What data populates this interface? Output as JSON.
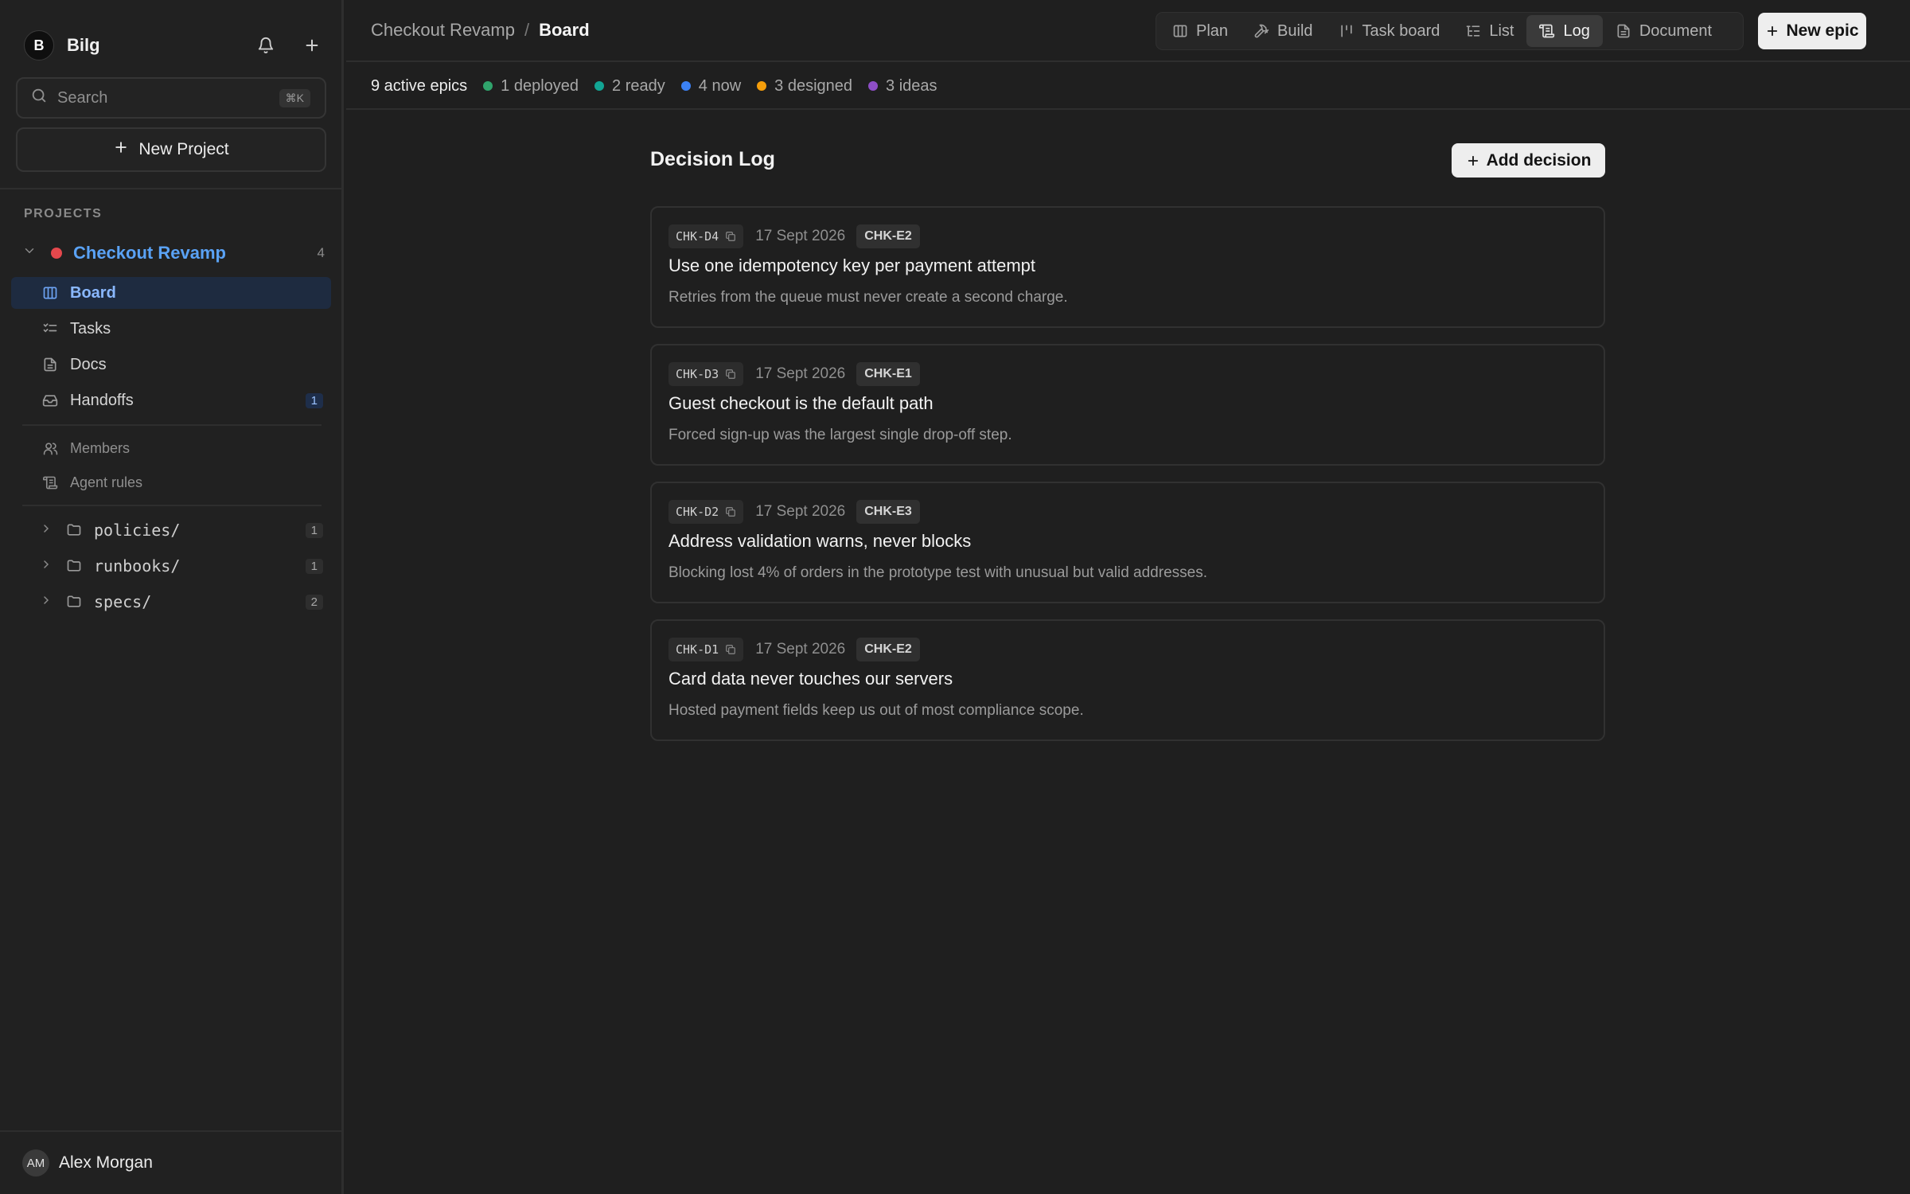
{
  "workspace": {
    "avatar_letter": "B",
    "name": "Bilg"
  },
  "search": {
    "placeholder": "Search",
    "shortcut": "⌘K"
  },
  "new_project_label": "New Project",
  "projects_label": "PROJECTS",
  "project": {
    "name": "Checkout Revamp",
    "count": "4",
    "dot_color": "#e5484d"
  },
  "nav": [
    {
      "label": "Board",
      "active": true,
      "icon": "board-icon"
    },
    {
      "label": "Tasks",
      "icon": "tasks-icon"
    },
    {
      "label": "Docs",
      "icon": "docs-icon"
    },
    {
      "label": "Handoffs",
      "icon": "inbox-icon",
      "badge": "1"
    }
  ],
  "subnav": [
    {
      "label": "Members",
      "icon": "members-icon"
    },
    {
      "label": "Agent rules",
      "icon": "scroll-icon"
    }
  ],
  "folders": [
    {
      "name": "policies/",
      "count": "1"
    },
    {
      "name": "runbooks/",
      "count": "1"
    },
    {
      "name": "specs/",
      "count": "2"
    }
  ],
  "user": {
    "initials": "AM",
    "name": "Alex Morgan"
  },
  "breadcrumb": {
    "parent": "Checkout Revamp",
    "separator": "/",
    "current": "Board"
  },
  "tabs": [
    {
      "label": "Plan",
      "icon": "columns-icon"
    },
    {
      "label": "Build",
      "icon": "hammer-icon"
    },
    {
      "label": "Task board",
      "icon": "kanban-icon"
    },
    {
      "label": "List",
      "icon": "list-icon"
    },
    {
      "label": "Log",
      "icon": "log-icon",
      "active": true
    },
    {
      "label": "Document",
      "icon": "document-icon"
    }
  ],
  "new_epic_label": "New epic",
  "status": {
    "total": "9 active epics",
    "items": [
      {
        "label": "1 deployed",
        "color": "#30a46c"
      },
      {
        "label": "2 ready",
        "color": "#12a594"
      },
      {
        "label": "4 now",
        "color": "#3b82f6"
      },
      {
        "label": "3 designed",
        "color": "#f59e0b"
      },
      {
        "label": "3 ideas",
        "color": "#8e4ec6"
      }
    ]
  },
  "log": {
    "title": "Decision Log",
    "add_label": "Add decision",
    "decisions": [
      {
        "code": "CHK-D4",
        "date": "17 Sept 2026",
        "epic": "CHK-E2",
        "title": "Use one idempotency key per payment attempt",
        "body": "Retries from the queue must never create a second charge."
      },
      {
        "code": "CHK-D3",
        "date": "17 Sept 2026",
        "epic": "CHK-E1",
        "title": "Guest checkout is the default path",
        "body": "Forced sign-up was the largest single drop-off step."
      },
      {
        "code": "CHK-D2",
        "date": "17 Sept 2026",
        "epic": "CHK-E3",
        "title": "Address validation warns, never blocks",
        "body": "Blocking lost 4% of orders in the prototype test with unusual but valid addresses."
      },
      {
        "code": "CHK-D1",
        "date": "17 Sept 2026",
        "epic": "CHK-E2",
        "title": "Card data never touches our servers",
        "body": "Hosted payment fields keep us out of most compliance scope."
      }
    ]
  }
}
